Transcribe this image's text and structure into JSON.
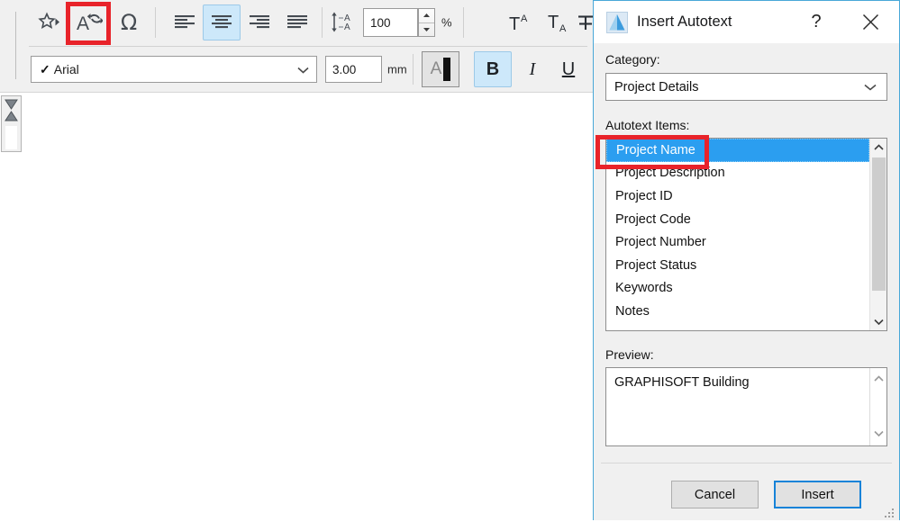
{
  "toolbar": {
    "buttons_row1": [
      {
        "name": "favorites-icon",
        "label": "Favorites"
      },
      {
        "name": "autotext-icon",
        "label": "Insert Autotext"
      },
      {
        "name": "special-character-icon",
        "label": "Ω"
      }
    ],
    "align_buttons": [
      {
        "name": "align-left-icon",
        "label": "Align Left",
        "active": false
      },
      {
        "name": "align-center-icon",
        "label": "Align Center",
        "active": true
      },
      {
        "name": "align-right-icon",
        "label": "Align Right",
        "active": false
      },
      {
        "name": "align-justify-icon",
        "label": "Justify",
        "active": false
      }
    ],
    "line_spacing": {
      "icon": "line-spacing-icon",
      "value": "100",
      "unit": "%"
    },
    "script_buttons": [
      {
        "name": "superscript-icon",
        "label": "Superscript"
      },
      {
        "name": "subscript-icon",
        "label": "Subscript"
      },
      {
        "name": "strikethrough-icon",
        "label": "Strikethrough"
      }
    ],
    "font": {
      "value": "Arial",
      "check": "✓"
    },
    "font_size": {
      "value": "3.00",
      "unit": "mm"
    },
    "style_buttons": [
      {
        "name": "text-color-button",
        "label": "A",
        "active": false
      },
      {
        "name": "bold-button",
        "label": "B",
        "active": true
      },
      {
        "name": "italic-button",
        "label": "I",
        "active": false
      },
      {
        "name": "underline-button",
        "label": "U",
        "active": false
      }
    ]
  },
  "dialog": {
    "title": "Insert Autotext",
    "help_label": "?",
    "close_label": "×",
    "category_label": "Category:",
    "category_value": "Project Details",
    "items_label": "Autotext Items:",
    "items": [
      "Project Name",
      "Project Description",
      "Project ID",
      "Project Code",
      "Project Number",
      "Project Status",
      "Keywords",
      "Notes"
    ],
    "selected_item_index": 0,
    "preview_label": "Preview:",
    "preview_value": "GRAPHISOFT Building",
    "cancel_label": "Cancel",
    "insert_label": "Insert"
  },
  "annotations": {
    "highlight_color": "#e8232a",
    "toolbar_highlight_target": "autotext-icon",
    "list_highlight_target": "Project Name"
  },
  "colors": {
    "accent_blue": "#2b9ef0",
    "dialog_border": "#49a8d8",
    "toolbar_bg": "#f0f0f0",
    "active_button_bg": "#cde8fa",
    "default_button_border": "#1683d8"
  }
}
